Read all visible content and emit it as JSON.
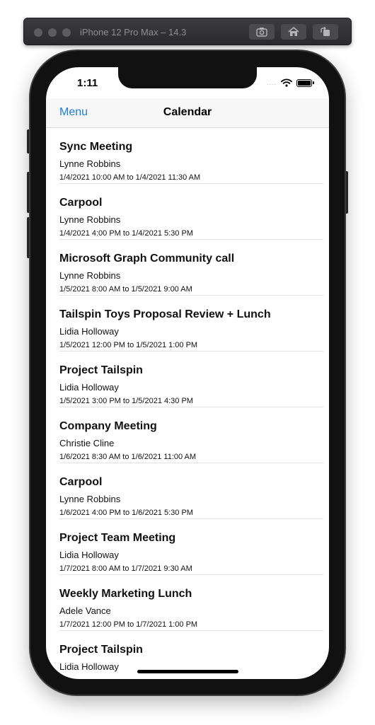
{
  "simulator": {
    "title": "iPhone 12 Pro Max – 14.3",
    "buttons": [
      "screenshot-icon",
      "home-icon",
      "rotate-icon"
    ]
  },
  "status_bar": {
    "time": "1:11",
    "signal_text": "....",
    "icons": [
      "wifi-icon",
      "battery-icon"
    ]
  },
  "navbar": {
    "menu_label": "Menu",
    "title": "Calendar",
    "accent_color": "#1a7ed6"
  },
  "events": [
    {
      "subject": "Sync Meeting",
      "organizer": "Lynne Robbins",
      "time": "1/4/2021 10:00 AM  to  1/4/2021 11:30 AM"
    },
    {
      "subject": "Carpool",
      "organizer": "Lynne Robbins",
      "time": "1/4/2021 4:00 PM  to  1/4/2021 5:30 PM"
    },
    {
      "subject": "Microsoft Graph Community call",
      "organizer": "Lynne Robbins",
      "time": "1/5/2021 8:00 AM  to  1/5/2021 9:00 AM"
    },
    {
      "subject": "Tailspin Toys Proposal Review + Lunch",
      "organizer": "Lidia Holloway",
      "time": "1/5/2021 12:00 PM  to  1/5/2021 1:00 PM"
    },
    {
      "subject": "Project Tailspin",
      "organizer": "Lidia Holloway",
      "time": "1/5/2021 3:00 PM  to  1/5/2021 4:30 PM"
    },
    {
      "subject": "Company Meeting",
      "organizer": "Christie Cline",
      "time": "1/6/2021 8:30 AM  to  1/6/2021 11:00 AM"
    },
    {
      "subject": "Carpool",
      "organizer": "Lynne Robbins",
      "time": "1/6/2021 4:00 PM  to  1/6/2021 5:30 PM"
    },
    {
      "subject": "Project Team Meeting",
      "organizer": "Lidia Holloway",
      "time": "1/7/2021 8:00 AM  to  1/7/2021 9:30 AM"
    },
    {
      "subject": "Weekly Marketing Lunch",
      "organizer": "Adele Vance",
      "time": "1/7/2021 12:00 PM  to  1/7/2021 1:00 PM"
    },
    {
      "subject": "Project Tailspin",
      "organizer": "Lidia Holloway",
      "time": ""
    }
  ]
}
